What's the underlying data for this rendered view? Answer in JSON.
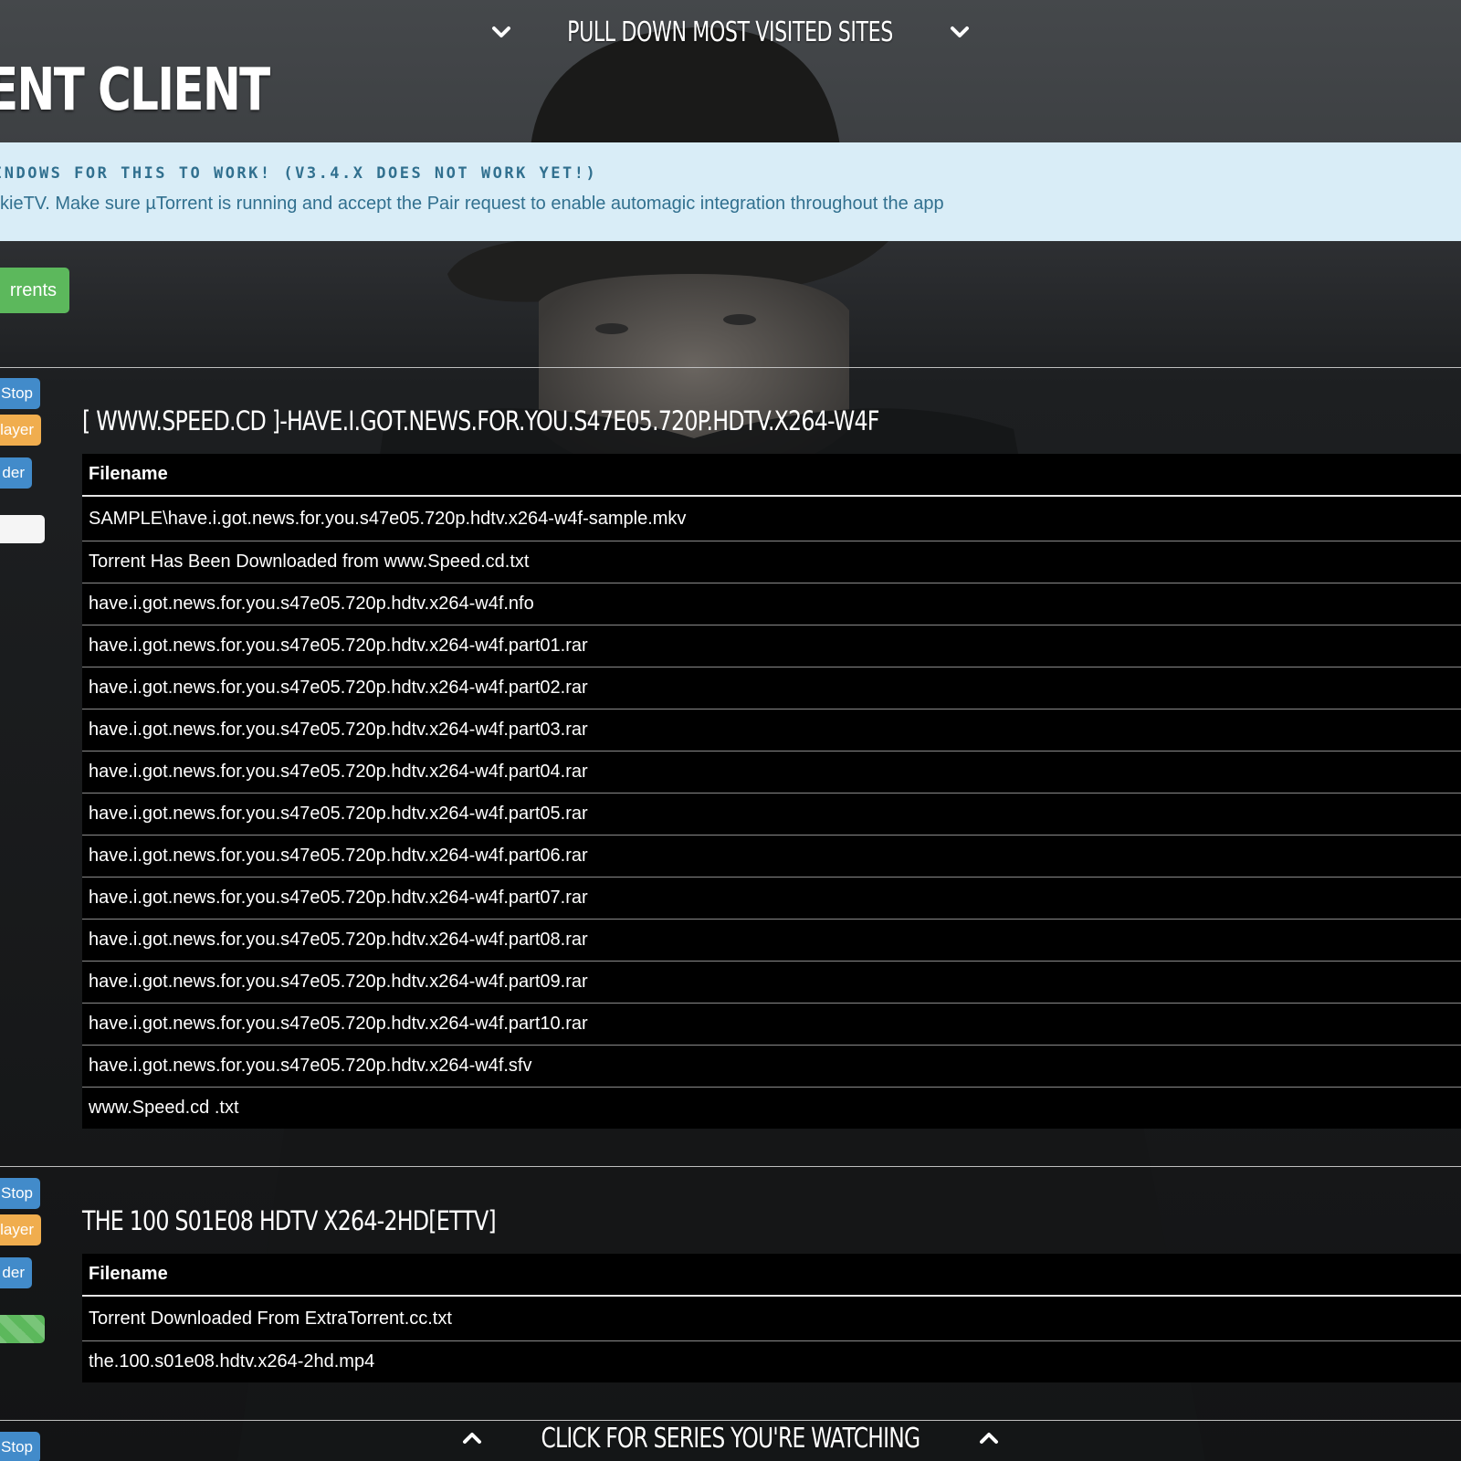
{
  "header": {
    "pulldown_label": "PULL DOWN MOST VISITED SITES",
    "page_title": "ENT CLIENT"
  },
  "alert": {
    "heading": "INDOWS FOR THIS TO WORK! (V3.4.X DOES NOT WORK YET!)",
    "body": "kieTV. Make sure µTorrent is running and accept the Pair request to enable automagic integration throughout the app"
  },
  "top_button": {
    "label": "rrents"
  },
  "torrents": [
    {
      "title": "[ WWW.SPEED.CD ]-HAVE.I.GOT.NEWS.FOR.YOU.S47E05.720P.HDTV.X264-W4F",
      "buttons": {
        "stop": "Stop",
        "player": "layer",
        "folder": "der"
      },
      "table_header": "Filename",
      "files": [
        "SAMPLE\\have.i.got.news.for.you.s47e05.720p.hdtv.x264-w4f-sample.mkv",
        "Torrent Has Been Downloaded from www.Speed.cd.txt",
        "have.i.got.news.for.you.s47e05.720p.hdtv.x264-w4f.nfo",
        "have.i.got.news.for.you.s47e05.720p.hdtv.x264-w4f.part01.rar",
        "have.i.got.news.for.you.s47e05.720p.hdtv.x264-w4f.part02.rar",
        "have.i.got.news.for.you.s47e05.720p.hdtv.x264-w4f.part03.rar",
        "have.i.got.news.for.you.s47e05.720p.hdtv.x264-w4f.part04.rar",
        "have.i.got.news.for.you.s47e05.720p.hdtv.x264-w4f.part05.rar",
        "have.i.got.news.for.you.s47e05.720p.hdtv.x264-w4f.part06.rar",
        "have.i.got.news.for.you.s47e05.720p.hdtv.x264-w4f.part07.rar",
        "have.i.got.news.for.you.s47e05.720p.hdtv.x264-w4f.part08.rar",
        "have.i.got.news.for.you.s47e05.720p.hdtv.x264-w4f.part09.rar",
        "have.i.got.news.for.you.s47e05.720p.hdtv.x264-w4f.part10.rar",
        "have.i.got.news.for.you.s47e05.720p.hdtv.x264-w4f.sfv",
        "www.Speed.cd .txt"
      ]
    },
    {
      "title": "THE 100 S01E08 HDTV X264-2HD[ETTV]",
      "buttons": {
        "stop": "Stop",
        "player": "layer",
        "folder": "der"
      },
      "table_header": "Filename",
      "files": [
        "Torrent Downloaded From ExtraTorrent.cc.txt",
        "the.100.s01e08.hdtv.x264-2hd.mp4"
      ]
    }
  ],
  "third_torrent": {
    "stop": "Stop"
  },
  "footer": {
    "label": "CLICK FOR SERIES YOU'RE WATCHING"
  },
  "colors": {
    "alert_bg": "#d9edf7",
    "alert_text": "#31708f",
    "btn_blue": "#428bca",
    "btn_orange": "#f0ad4e",
    "btn_green": "#5cb85c"
  },
  "icons": {
    "pulldown": "chevron-down-icon",
    "footer": "chevron-up-icon"
  }
}
